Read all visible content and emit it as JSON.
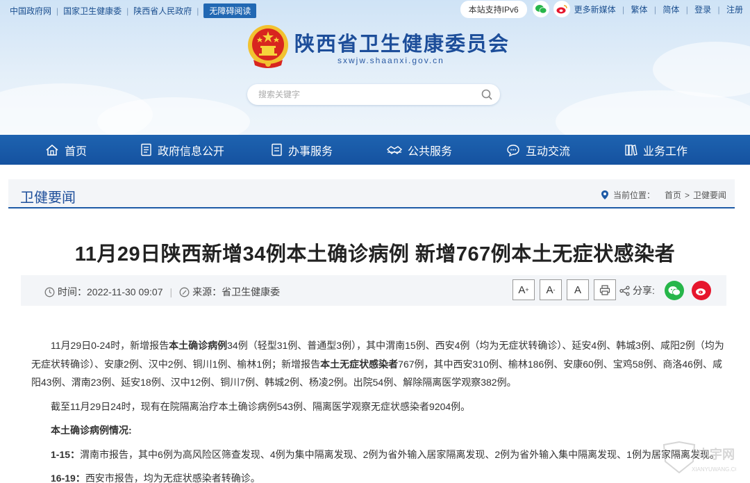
{
  "top_links": [
    "中国政府网",
    "国家卫生健康委",
    "陕西省人民政府"
  ],
  "accessibility_label": "无障碍阅读",
  "ipv6_label": "本站支持IPv6",
  "more_media": "更多新媒体",
  "lang_trad": "繁体",
  "lang_simp": "简体",
  "login": "登录",
  "register": "注册",
  "site": {
    "title": "陕西省卫生健康委员会",
    "domain": "sxwjw.shaanxi.gov.cn"
  },
  "search": {
    "placeholder": "搜索关键字"
  },
  "nav": [
    {
      "label": "首页",
      "icon": "home-icon"
    },
    {
      "label": "政府信息公开",
      "icon": "document-icon"
    },
    {
      "label": "办事服务",
      "icon": "form-icon"
    },
    {
      "label": "公共服务",
      "icon": "handshake-icon"
    },
    {
      "label": "互动交流",
      "icon": "chat-icon"
    },
    {
      "label": "业务工作",
      "icon": "books-icon"
    }
  ],
  "column": {
    "title": "卫健要闻",
    "breadcrumb_label": "当前位置：",
    "breadcrumb": [
      "首页",
      "卫健要闻"
    ],
    "breadcrumb_sep": ">"
  },
  "article": {
    "title": "11月29日陕西新增34例本土确诊病例 新增767例本土无症状感染者",
    "time_label": "时间：",
    "time": "2022-11-30 09:07",
    "source_label": "来源：",
    "source": "省卫生健康委",
    "font_large": "A",
    "font_small": "A",
    "font_default": "A",
    "share_label": "分享:",
    "p1_a": "11月29日0-24时，新增报告",
    "p1_b": "本土确诊病例",
    "p1_c": "34例（轻型31例、普通型3例），其中渭南15例、西安4例（均为无症状转确诊）、延安4例、韩城3例、咸阳2例（均为无症状转确诊）、安康2例、汉中2例、铜川1例、榆林1例；新增报告",
    "p1_d": "本土无症状感染者",
    "p1_e": "767例，其中西安310例、榆林186例、安康60例、宝鸡58例、商洛46例、咸阳43例、渭南23例、延安18例、汉中12例、铜川7例、韩城2例、杨凌2例。出院54例、解除隔离医学观察382例。",
    "p2": "截至11月29日24时，现有在院隔离治疗本土确诊病例543例、隔离医学观察无症状感染者9204例。",
    "p3": "本土确诊病例情况:",
    "p4_a": "1-15：",
    "p4_b": "渭南市报告，其中6例为高风险区筛查发现、4例为集中隔离发现、2例为省外输入居家隔离发现、2例为省外输入集中隔离发现、1例为居家隔离发现。",
    "p5_a": "16-19：",
    "p5_b": "西安市报告，均为无症状感染者转确诊。"
  },
  "watermark": {
    "text": "中宇网",
    "sub": "XIANYUWANG.COM"
  },
  "colors": {
    "brand_blue": "#1d5aa6",
    "nav_blue": "#1552a0",
    "wechat_green": "#27b64a",
    "weibo_red": "#e6162d"
  }
}
